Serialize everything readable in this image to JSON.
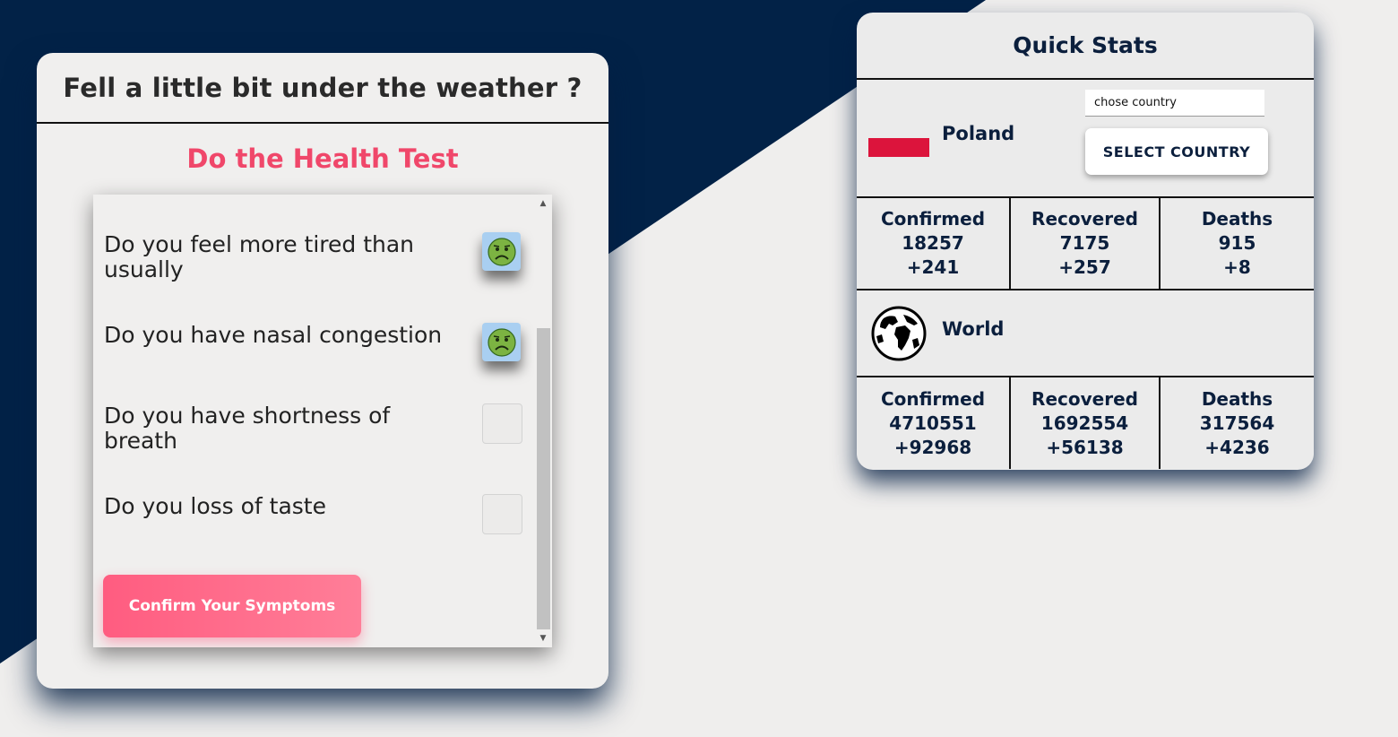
{
  "health": {
    "title": "Fell a little bit under the weather ?",
    "subtitle": "Do the Health Test",
    "questions": [
      {
        "text": "Do you feel more tired than usually",
        "checked": true
      },
      {
        "text": "Do you have nasal congestion",
        "checked": true
      },
      {
        "text": "Do you have shortness of breath",
        "checked": false
      },
      {
        "text": "Do you loss of taste",
        "checked": false
      }
    ],
    "confirm_label": "Confirm Your Symptoms",
    "checked_icon": "sick-face-icon"
  },
  "stats": {
    "title": "Quick Stats",
    "country": {
      "name": "Poland",
      "flag_icon": "poland-flag-icon",
      "input_placeholder": "chose country",
      "select_label": "SELECT COUNTRY",
      "confirmed_label": "Confirmed",
      "confirmed": "18257",
      "confirmed_new": "+241",
      "recovered_label": "Recovered",
      "recovered": "7175",
      "recovered_new": "+257",
      "deaths_label": "Deaths",
      "deaths": "915",
      "deaths_new": "+8"
    },
    "world": {
      "name": "World",
      "icon": "globe-icon",
      "confirmed_label": "Confirmed",
      "confirmed": "4710551",
      "confirmed_new": "+92968",
      "recovered_label": "Recovered",
      "recovered": "1692554",
      "recovered_new": "+56138",
      "deaths_label": "Deaths",
      "deaths": "317564",
      "deaths_new": "+4236"
    }
  },
  "colors": {
    "navy": "#022247",
    "accent_pink": "#f0476a",
    "button_gradient_start": "#ff5c80",
    "button_gradient_end": "#ff7e98",
    "checked_bg": "#a9cff1",
    "flag_red": "#dc143c"
  }
}
